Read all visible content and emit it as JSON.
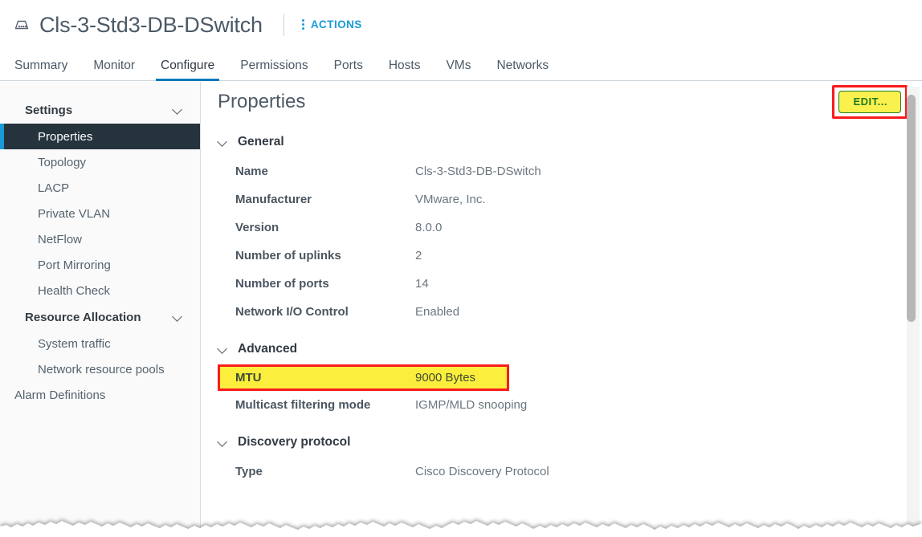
{
  "header": {
    "object_icon": "distributed-switch-icon",
    "title": "Cls-3-Std3-DB-DSwitch",
    "actions_label": "ACTIONS",
    "actions_icon": "kebab-menu-icon"
  },
  "tabs": [
    {
      "label": "Summary",
      "active": false
    },
    {
      "label": "Monitor",
      "active": false
    },
    {
      "label": "Configure",
      "active": true
    },
    {
      "label": "Permissions",
      "active": false
    },
    {
      "label": "Ports",
      "active": false
    },
    {
      "label": "Hosts",
      "active": false
    },
    {
      "label": "VMs",
      "active": false
    },
    {
      "label": "Networks",
      "active": false
    }
  ],
  "sidebar": {
    "groups": [
      {
        "label": "Settings",
        "chevron": "chevron-down-icon",
        "items": [
          {
            "label": "Properties",
            "selected": true
          },
          {
            "label": "Topology",
            "selected": false
          },
          {
            "label": "LACP",
            "selected": false
          },
          {
            "label": "Private VLAN",
            "selected": false
          },
          {
            "label": "NetFlow",
            "selected": false
          },
          {
            "label": "Port Mirroring",
            "selected": false
          },
          {
            "label": "Health Check",
            "selected": false
          }
        ]
      },
      {
        "label": "Resource Allocation",
        "chevron": "chevron-down-icon",
        "items": [
          {
            "label": "System traffic",
            "selected": false
          },
          {
            "label": "Network resource pools",
            "selected": false
          }
        ]
      }
    ],
    "standalone_item": {
      "label": "Alarm Definitions",
      "selected": false
    }
  },
  "content": {
    "page_title": "Properties",
    "edit_button": {
      "label": "EDIT...",
      "fill_color": "#fbf14e",
      "border_color": "#1f7a21",
      "text_color": "#1f7a21",
      "annotation_color": "#fa1a1a"
    },
    "sections": [
      {
        "title": "General",
        "chevron": "chevron-down-icon",
        "rows": [
          {
            "key": "Name",
            "value": "Cls-3-Std3-DB-DSwitch",
            "highlight": false
          },
          {
            "key": "Manufacturer",
            "value": "VMware, Inc.",
            "highlight": false
          },
          {
            "key": "Version",
            "value": "8.0.0",
            "highlight": false
          },
          {
            "key": "Number of uplinks",
            "value": "2",
            "highlight": false
          },
          {
            "key": "Number of ports",
            "value": "14",
            "highlight": false
          },
          {
            "key": "Network I/O Control",
            "value": "Enabled",
            "highlight": false
          }
        ]
      },
      {
        "title": "Advanced",
        "chevron": "chevron-down-icon",
        "rows": [
          {
            "key": "MTU",
            "value": "9000 Bytes",
            "highlight": true,
            "highlight_color": "#fbee3d",
            "annotation_color": "#fa1a1a"
          },
          {
            "key": "Multicast filtering mode",
            "value": "IGMP/MLD snooping",
            "highlight": false
          }
        ]
      },
      {
        "title": "Discovery protocol",
        "chevron": "chevron-down-icon",
        "rows": [
          {
            "key": "Type",
            "value": "Cisco Discovery Protocol",
            "highlight": false
          }
        ]
      }
    ]
  },
  "scrollbar": {
    "orientation": "vertical",
    "name": "content-scrollbar"
  },
  "theme": {
    "accent_blue": "#0079b8",
    "link_blue": "#1a9bd7",
    "selected_nav_bg": "#25333d",
    "text_dark": "#333b44",
    "text_muted": "#6b7780",
    "sidebar_bg": "#fafafa"
  }
}
